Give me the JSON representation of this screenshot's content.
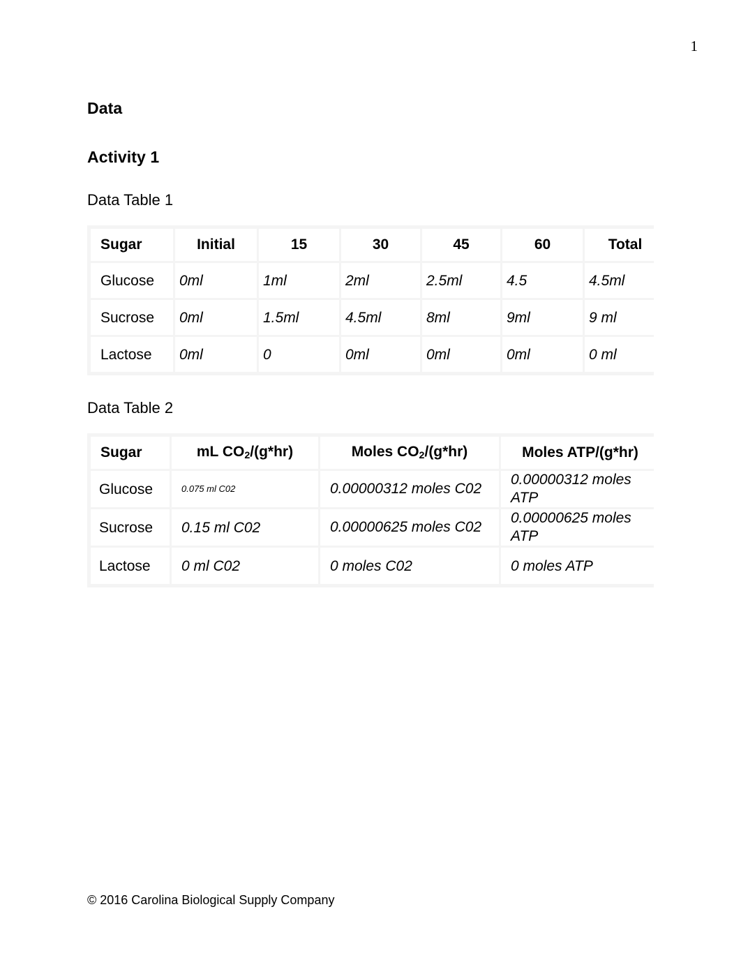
{
  "page": {
    "number": "1",
    "footer": "© 2016 Carolina Biological Supply Company"
  },
  "headings": {
    "data": "Data",
    "activity": "Activity 1",
    "table1_label": "Data Table 1",
    "table2_label": "Data Table 2"
  },
  "colors": {
    "value_blue": "#2e74b5",
    "table_background": "#f4f4f4",
    "cell_background": "#ffffff"
  },
  "table1": {
    "headers": [
      "Sugar",
      "Initial",
      "15",
      "30",
      "45",
      "60",
      "Total"
    ],
    "rows": [
      {
        "sugar": "Glucose",
        "initial": "0ml",
        "t15": "1ml",
        "t30": "2ml",
        "t45": "2.5ml",
        "t60": "4.5",
        "total": "4.5ml"
      },
      {
        "sugar": "Sucrose",
        "initial": "0ml",
        "t15": "1.5ml",
        "t30": "4.5ml",
        "t45": "8ml",
        "t60": "9ml",
        "total": "9 ml"
      },
      {
        "sugar": "Lactose",
        "initial": "0ml",
        "t15": "0",
        "t30": "0ml",
        "t45": "0ml",
        "t60": "0ml",
        "total": "0 ml"
      }
    ]
  },
  "table2": {
    "headers": {
      "sugar": "Sugar",
      "ml_co2_pre": "mL CO",
      "ml_co2_sub": "2",
      "ml_co2_post": "/(g*hr)",
      "moles_co2_pre": "Moles CO",
      "moles_co2_sub": "2",
      "moles_co2_post": "/(g*hr)",
      "moles_atp": "Moles ATP/(g*hr)"
    },
    "rows": [
      {
        "sugar": "Glucose",
        "ml_co2": "0.075 ml C02",
        "moles_co2": "0.00000312 moles C02",
        "moles_atp": "0.00000312 moles ATP"
      },
      {
        "sugar": "Sucrose",
        "ml_co2": "0.15 ml C02",
        "moles_co2": "0.00000625 moles C02",
        "moles_atp": "0.00000625 moles ATP"
      },
      {
        "sugar": "Lactose",
        "ml_co2": "0 ml C02",
        "moles_co2": "0 moles C02",
        "moles_atp": "0 moles ATP"
      }
    ]
  }
}
